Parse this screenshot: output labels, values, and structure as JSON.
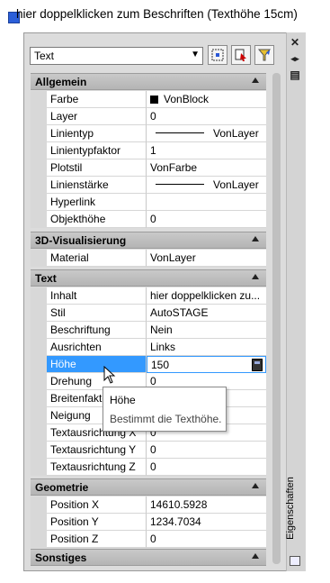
{
  "top_text": "hier doppelklicken zum Beschriften (Texthöhe 15cm)",
  "palette": {
    "object_type": "Text",
    "toolbar": {
      "quickselect_icon": "quick-select-icon",
      "pickadd_icon": "pickadd-icon",
      "selectobjects_icon": "select-objects-icon"
    },
    "side_icons": {
      "close": "✕",
      "autohide": "◂▸",
      "properties": "▤"
    },
    "side_label": "Eigenschaften",
    "categories": [
      {
        "label": "Allgemein",
        "rows": [
          {
            "name": "Farbe",
            "value": "VonBlock"
          },
          {
            "name": "Layer",
            "value": "0"
          },
          {
            "name": "Linientyp",
            "value": "VonLayer"
          },
          {
            "name": "Linientypfaktor",
            "value": "1"
          },
          {
            "name": "Plotstil",
            "value": "VonFarbe"
          },
          {
            "name": "Linienstärke",
            "value": "VonLayer"
          },
          {
            "name": "Hyperlink",
            "value": ""
          },
          {
            "name": "Objekthöhe",
            "value": "0"
          }
        ]
      },
      {
        "label": "3D-Visualisierung",
        "rows": [
          {
            "name": "Material",
            "value": "VonLayer"
          }
        ]
      },
      {
        "label": "Text",
        "rows": [
          {
            "name": "Inhalt",
            "value": "hier doppelklicken zu..."
          },
          {
            "name": "Stil",
            "value": "AutoSTAGE"
          },
          {
            "name": "Beschriftung",
            "value": "Nein"
          },
          {
            "name": "Ausrichten",
            "value": "Links"
          },
          {
            "name": "Höhe",
            "value": "150"
          },
          {
            "name": "Drehung",
            "value": "0"
          },
          {
            "name": "Breitenfaktor",
            "value": ""
          },
          {
            "name": "Neigung",
            "value": ""
          },
          {
            "name": "Textausrichtung X",
            "value": "0"
          },
          {
            "name": "Textausrichtung Y",
            "value": "0"
          },
          {
            "name": "Textausrichtung Z",
            "value": "0"
          }
        ]
      },
      {
        "label": "Geometrie",
        "rows": [
          {
            "name": "Position X",
            "value": "14610.5928"
          },
          {
            "name": "Position Y",
            "value": "1234.7034"
          },
          {
            "name": "Position Z",
            "value": "0"
          }
        ]
      },
      {
        "label": "Sonstiges",
        "rows": []
      }
    ],
    "tooltip": {
      "title": "Höhe",
      "description": "Bestimmt die Texthöhe."
    }
  },
  "colors": {
    "selection": "#3399ff",
    "category_bg": "#bdbdbd",
    "marker_blue": "#2b5fd9"
  }
}
